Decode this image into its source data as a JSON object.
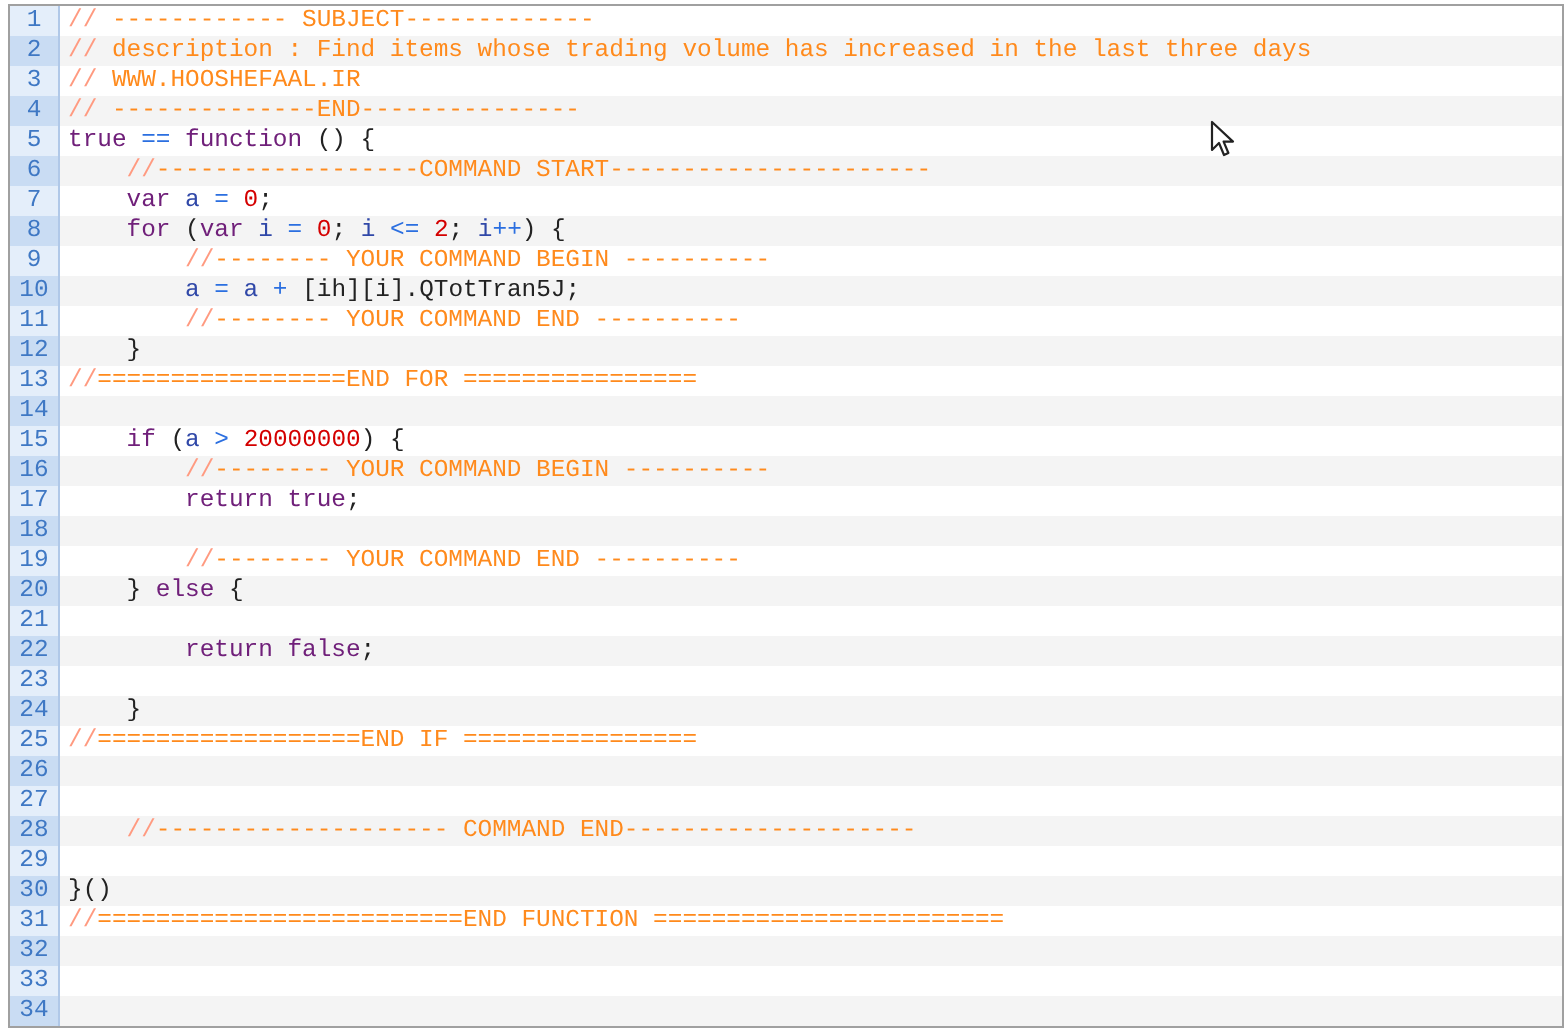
{
  "editor": {
    "lines": [
      {
        "number": "1",
        "tokens": [
          {
            "kind": "slash",
            "text": "//"
          },
          {
            "kind": "comment",
            "text": " ------------ SUBJECT-------------"
          }
        ]
      },
      {
        "number": "2",
        "tokens": [
          {
            "kind": "slash",
            "text": "//"
          },
          {
            "kind": "comment",
            "text": " description : Find items whose trading volume has increased in the last three days"
          }
        ]
      },
      {
        "number": "3",
        "tokens": [
          {
            "kind": "slash",
            "text": "//"
          },
          {
            "kind": "comment",
            "text": " WWW.HOOSHEFAAL.IR"
          }
        ]
      },
      {
        "number": "4",
        "tokens": [
          {
            "kind": "slash",
            "text": "//"
          },
          {
            "kind": "comment",
            "text": " --------------END---------------"
          }
        ]
      },
      {
        "number": "5",
        "tokens": [
          {
            "kind": "keyword",
            "text": "true "
          },
          {
            "kind": "operator",
            "text": "=="
          },
          {
            "kind": "keyword",
            "text": " function"
          },
          {
            "kind": "plain",
            "text": " () {"
          }
        ]
      },
      {
        "number": "6",
        "tokens": [
          {
            "kind": "slash",
            "text": "    //"
          },
          {
            "kind": "comment",
            "text": "------------------COMMAND START----------------------"
          }
        ]
      },
      {
        "number": "7",
        "tokens": [
          {
            "kind": "keyword",
            "text": "    var "
          },
          {
            "kind": "variable",
            "text": "a"
          },
          {
            "kind": "operator",
            "text": " = "
          },
          {
            "kind": "number",
            "text": "0"
          },
          {
            "kind": "plain",
            "text": ";"
          }
        ]
      },
      {
        "number": "8",
        "tokens": [
          {
            "kind": "keyword",
            "text": "    for"
          },
          {
            "kind": "plain",
            "text": " ("
          },
          {
            "kind": "keyword",
            "text": "var "
          },
          {
            "kind": "variable",
            "text": "i"
          },
          {
            "kind": "operator",
            "text": " = "
          },
          {
            "kind": "number",
            "text": "0"
          },
          {
            "kind": "plain",
            "text": "; "
          },
          {
            "kind": "variable",
            "text": "i"
          },
          {
            "kind": "operator",
            "text": " <= "
          },
          {
            "kind": "number",
            "text": "2"
          },
          {
            "kind": "plain",
            "text": "; "
          },
          {
            "kind": "variable",
            "text": "i"
          },
          {
            "kind": "operator",
            "text": "++"
          },
          {
            "kind": "plain",
            "text": ") {"
          }
        ]
      },
      {
        "number": "9",
        "tokens": [
          {
            "kind": "slash",
            "text": "        //"
          },
          {
            "kind": "comment",
            "text": "-------- YOUR COMMAND BEGIN ----------"
          }
        ]
      },
      {
        "number": "10",
        "tokens": [
          {
            "kind": "variable",
            "text": "        a"
          },
          {
            "kind": "operator",
            "text": " = "
          },
          {
            "kind": "variable",
            "text": "a"
          },
          {
            "kind": "operator",
            "text": " + "
          },
          {
            "kind": "plain",
            "text": "[ih][i].QTotTran5J;"
          }
        ]
      },
      {
        "number": "11",
        "tokens": [
          {
            "kind": "slash",
            "text": "        //"
          },
          {
            "kind": "comment",
            "text": "-------- YOUR COMMAND END ----------"
          }
        ]
      },
      {
        "number": "12",
        "tokens": [
          {
            "kind": "plain",
            "text": "    }"
          }
        ]
      },
      {
        "number": "13",
        "tokens": [
          {
            "kind": "slash",
            "text": "//"
          },
          {
            "kind": "comment",
            "text": "=================END FOR ================"
          }
        ]
      },
      {
        "number": "14"
      },
      {
        "number": "15",
        "tokens": [
          {
            "kind": "keyword",
            "text": "    if"
          },
          {
            "kind": "plain",
            "text": " ("
          },
          {
            "kind": "variable",
            "text": "a"
          },
          {
            "kind": "operator",
            "text": " > "
          },
          {
            "kind": "number",
            "text": "20000000"
          },
          {
            "kind": "plain",
            "text": ") {"
          }
        ]
      },
      {
        "number": "16",
        "tokens": [
          {
            "kind": "slash",
            "text": "        //"
          },
          {
            "kind": "comment",
            "text": "-------- YOUR COMMAND BEGIN ----------"
          }
        ]
      },
      {
        "number": "17",
        "tokens": [
          {
            "kind": "keyword",
            "text": "        return true"
          },
          {
            "kind": "plain",
            "text": ";"
          }
        ]
      },
      {
        "number": "18"
      },
      {
        "number": "19",
        "tokens": [
          {
            "kind": "slash",
            "text": "        //"
          },
          {
            "kind": "comment",
            "text": "-------- YOUR COMMAND END ----------"
          }
        ]
      },
      {
        "number": "20",
        "tokens": [
          {
            "kind": "plain",
            "text": "    } "
          },
          {
            "kind": "keyword",
            "text": "else"
          },
          {
            "kind": "plain",
            "text": " {"
          }
        ]
      },
      {
        "number": "21"
      },
      {
        "number": "22",
        "tokens": [
          {
            "kind": "keyword",
            "text": "        return false"
          },
          {
            "kind": "plain",
            "text": ";"
          }
        ]
      },
      {
        "number": "23"
      },
      {
        "number": "24",
        "tokens": [
          {
            "kind": "plain",
            "text": "    }"
          }
        ]
      },
      {
        "number": "25",
        "tokens": [
          {
            "kind": "slash",
            "text": "//"
          },
          {
            "kind": "comment",
            "text": "==================END IF ================"
          }
        ]
      },
      {
        "number": "26"
      },
      {
        "number": "27"
      },
      {
        "number": "28",
        "tokens": [
          {
            "kind": "slash",
            "text": "    //"
          },
          {
            "kind": "comment",
            "text": "-------------------- COMMAND END--------------------"
          }
        ]
      },
      {
        "number": "29"
      },
      {
        "number": "30",
        "tokens": [
          {
            "kind": "plain",
            "text": "}()"
          }
        ]
      },
      {
        "number": "31",
        "tokens": [
          {
            "kind": "slash",
            "text": "//"
          },
          {
            "kind": "comment",
            "text": "=========================END FUNCTION ========================"
          }
        ]
      },
      {
        "number": "32"
      },
      {
        "number": "33"
      },
      {
        "number": "34"
      }
    ]
  }
}
